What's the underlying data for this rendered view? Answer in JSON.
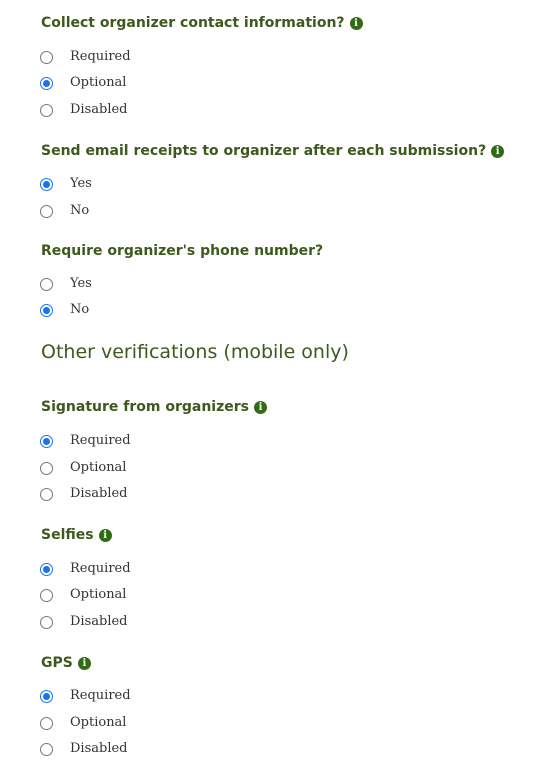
{
  "questions": [
    {
      "label": "Collect organizer contact information?",
      "has_info": true,
      "options": [
        {
          "label": "Required",
          "checked": false
        },
        {
          "label": "Optional",
          "checked": true
        },
        {
          "label": "Disabled",
          "checked": false
        }
      ]
    },
    {
      "label": "Send email receipts to organizer after each submission?",
      "has_info": true,
      "options": [
        {
          "label": "Yes",
          "checked": true
        },
        {
          "label": "No",
          "checked": false
        }
      ]
    },
    {
      "label": "Require organizer's phone number?",
      "has_info": false,
      "options": [
        {
          "label": "Yes",
          "checked": false
        },
        {
          "label": "No",
          "checked": true
        }
      ]
    }
  ],
  "other_section": {
    "heading": "Other verifications (mobile only)",
    "questions": [
      {
        "label": "Signature from organizers",
        "has_info": true,
        "options": [
          {
            "label": "Required",
            "checked": true
          },
          {
            "label": "Optional",
            "checked": false
          },
          {
            "label": "Disabled",
            "checked": false
          }
        ]
      },
      {
        "label": "Selfies",
        "has_info": true,
        "options": [
          {
            "label": "Required",
            "checked": true
          },
          {
            "label": "Optional",
            "checked": false
          },
          {
            "label": "Disabled",
            "checked": false
          }
        ]
      },
      {
        "label": "GPS",
        "has_info": true,
        "options": [
          {
            "label": "Required",
            "checked": true
          },
          {
            "label": "Optional",
            "checked": false
          },
          {
            "label": "Disabled",
            "checked": false
          }
        ]
      }
    ]
  },
  "icons": {
    "info_glyph": "i",
    "info_color": "#2f6d14",
    "radio_checked_color": "#1a73e8"
  }
}
